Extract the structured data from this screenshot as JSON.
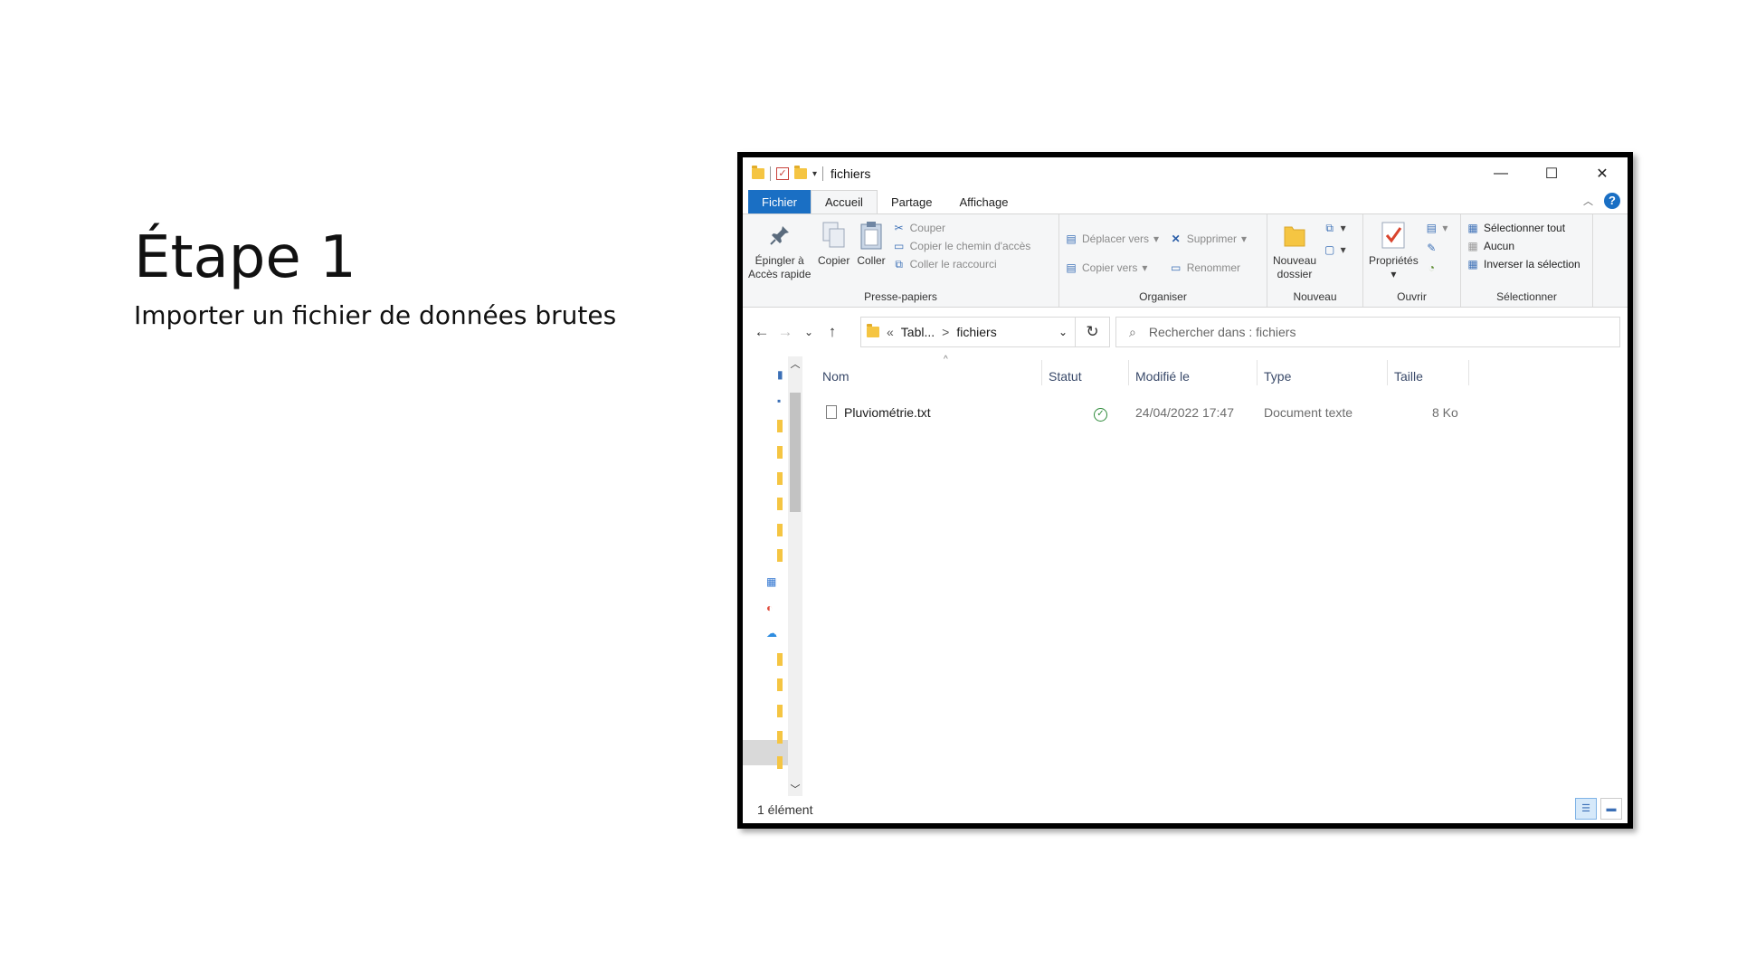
{
  "slide": {
    "title": "Étape 1",
    "subtitle": "Importer un fichier de données brutes"
  },
  "window": {
    "title": "fichiers",
    "controls": {
      "minimize": "—",
      "maximize": "☐",
      "close": "✕"
    }
  },
  "ribbon": {
    "tabs": [
      "Fichier",
      "Accueil",
      "Partage",
      "Affichage"
    ],
    "groups": {
      "clipboard": {
        "label": "Presse-papiers",
        "pin": "Épingler à",
        "pin2": "Accès rapide",
        "copy": "Copier",
        "paste": "Coller",
        "cut": "Couper",
        "copy_path": "Copier le chemin d'accès",
        "paste_shortcut": "Coller le raccourci"
      },
      "organize": {
        "label": "Organiser",
        "move_to": "Déplacer vers",
        "copy_to": "Copier vers",
        "delete": "Supprimer",
        "rename": "Renommer"
      },
      "new": {
        "label": "Nouveau",
        "new_folder": "Nouveau",
        "new_folder2": "dossier"
      },
      "open": {
        "label": "Ouvrir",
        "properties": "Propriétés"
      },
      "select": {
        "label": "Sélectionner",
        "select_all": "Sélectionner tout",
        "none": "Aucun",
        "invert": "Inverser la sélection"
      }
    }
  },
  "addressbar": {
    "prefix": "«",
    "crumb1": "Tabl...",
    "crumb_sep": ">",
    "crumb2": "fichiers",
    "search_placeholder": "Rechercher dans : fichiers"
  },
  "filelist": {
    "columns": [
      "Nom",
      "Statut",
      "Modifié le",
      "Type",
      "Taille"
    ],
    "rows": [
      {
        "name": "Pluviométrie.txt",
        "modified": "24/04/2022 17:47",
        "type": "Document texte",
        "size": "8 Ko"
      }
    ]
  },
  "statusbar": {
    "count": "1 élément"
  },
  "colors": {
    "accent": "#1a6fc4",
    "status_ok": "#2e8b3a",
    "folder": "#f5c542"
  }
}
